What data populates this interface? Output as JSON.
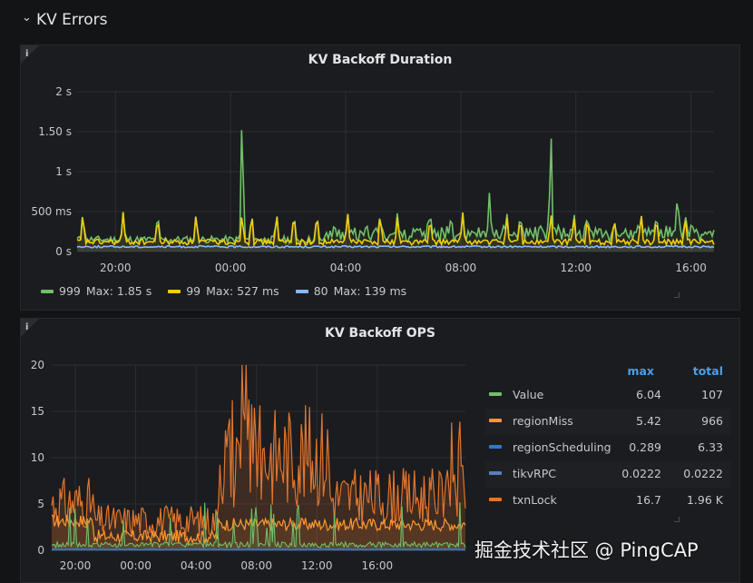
{
  "row": {
    "title": "KV Errors",
    "chevron": "⌄"
  },
  "panels": [
    {
      "title": "KV Backoff Duration",
      "info": "i",
      "legend": [
        {
          "name": "999",
          "stat": "Max: 1.85 s",
          "color": "#73bf69"
        },
        {
          "name": "99",
          "stat": "Max: 527 ms",
          "color": "#f2cc0c"
        },
        {
          "name": "80",
          "stat": "Max: 139 ms",
          "color": "#8ab8ff"
        }
      ]
    },
    {
      "title": "KV Backoff OPS",
      "info": "i",
      "legend_headers": {
        "max": "max",
        "total": "total"
      },
      "legend": [
        {
          "name": "Value",
          "max": "6.04",
          "total": "107",
          "color": "#73bf69"
        },
        {
          "name": "regionMiss",
          "max": "5.42",
          "total": "966",
          "color": "#ff9830"
        },
        {
          "name": "regionScheduling",
          "max": "0.289",
          "total": "6.33",
          "color": "#3274d9"
        },
        {
          "name": "tikvRPC",
          "max": "0.0222",
          "total": "0.0222",
          "color": "#5a7fbf"
        },
        {
          "name": "txnLock",
          "max": "16.7",
          "total": "1.96 K",
          "color": "#e0752d"
        }
      ]
    }
  ],
  "chart_data": [
    {
      "type": "line",
      "title": "KV Backoff Duration",
      "x_ticks": [
        "20:00",
        "00:00",
        "04:00",
        "08:00",
        "12:00",
        "16:00"
      ],
      "y_ticks": [
        "0 s",
        "500 ms",
        "1 s",
        "1.50 s",
        "2 s"
      ],
      "ylim": [
        0,
        2
      ],
      "yunit": "s",
      "grid": true,
      "legend_position": "bottom",
      "series": [
        {
          "name": "999",
          "color": "#73bf69",
          "baseline": 0.15,
          "max": 1.85,
          "peaks": [
            [
              0.3,
              0.5
            ],
            [
              2.4,
              0.5
            ],
            [
              4.2,
              0.5
            ],
            [
              6.2,
              0.5
            ],
            [
              8.6,
              1.85
            ],
            [
              9.1,
              0.5
            ],
            [
              10.4,
              0.5
            ],
            [
              11.3,
              0.5
            ],
            [
              12.5,
              0.5
            ],
            [
              14.1,
              0.5
            ],
            [
              15.8,
              0.5
            ],
            [
              16.7,
              0.5
            ],
            [
              18.4,
              0.55
            ],
            [
              19.5,
              0.5
            ],
            [
              20.1,
              0.5
            ],
            [
              21.5,
              0.8
            ],
            [
              22.4,
              0.5
            ],
            [
              23.1,
              0.5
            ],
            [
              24.7,
              1.6
            ],
            [
              25.9,
              0.5
            ],
            [
              26.6,
              0.5
            ],
            [
              28.0,
              0.4
            ],
            [
              29.4,
              0.5
            ],
            [
              30.2,
              0.5
            ],
            [
              31.3,
              0.8
            ],
            [
              31.7,
              0.5
            ]
          ]
        },
        {
          "name": "99",
          "color": "#f2cc0c",
          "baseline": 0.12,
          "max": 0.527,
          "peaks": [
            [
              0.3,
              0.5
            ],
            [
              2.4,
              0.5
            ],
            [
              4.2,
              0.45
            ],
            [
              6.2,
              0.5
            ],
            [
              8.6,
              0.5
            ],
            [
              9.1,
              0.5
            ],
            [
              10.4,
              0.5
            ],
            [
              11.3,
              0.5
            ],
            [
              12.5,
              0.5
            ],
            [
              14.1,
              0.5
            ],
            [
              15.8,
              0.5
            ],
            [
              16.7,
              0.45
            ],
            [
              18.4,
              0.45
            ],
            [
              20.1,
              0.5
            ],
            [
              22.4,
              0.45
            ],
            [
              23.1,
              0.45
            ],
            [
              24.7,
              0.5
            ],
            [
              25.9,
              0.45
            ],
            [
              26.6,
              0.45
            ],
            [
              28.0,
              0.45
            ],
            [
              29.4,
              0.5
            ],
            [
              30.2,
              0.45
            ],
            [
              31.7,
              0.45
            ]
          ]
        },
        {
          "name": "80",
          "color": "#8ab8ff",
          "baseline": 0.06,
          "max": 0.139
        }
      ]
    },
    {
      "type": "area",
      "title": "KV Backoff OPS",
      "x_ticks": [
        "20:00",
        "00:00",
        "04:00",
        "08:00",
        "12:00",
        "16:00"
      ],
      "y_ticks": [
        "0",
        "5",
        "10",
        "15",
        "20"
      ],
      "ylim": [
        0,
        20
      ],
      "grid": true,
      "legend_position": "right",
      "series": [
        {
          "name": "Value",
          "color": "#73bf69",
          "max": 6.04,
          "total": 107
        },
        {
          "name": "regionMiss",
          "color": "#ff9830",
          "max": 5.42,
          "total": 966
        },
        {
          "name": "regionScheduling",
          "color": "#3274d9",
          "max": 0.289,
          "total": 6.33
        },
        {
          "name": "tikvRPC",
          "color": "#5a7fbf",
          "max": 0.0222,
          "total": 0.0222
        },
        {
          "name": "txnLock",
          "color": "#e0752d",
          "max": 16.7,
          "total": 1960
        }
      ]
    }
  ],
  "watermark": "掘金技术社区 @ PingCAP"
}
